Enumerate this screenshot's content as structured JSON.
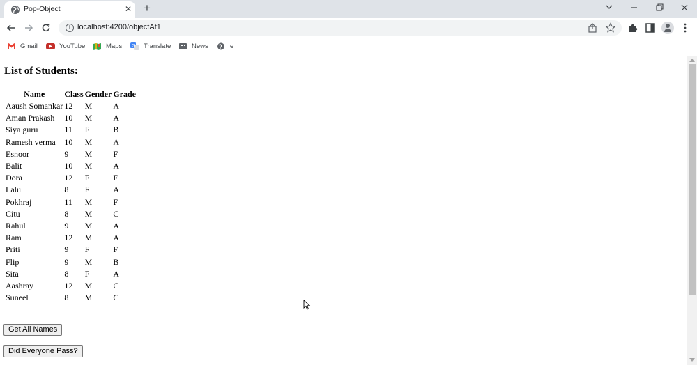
{
  "browser": {
    "tab_title": "Pop-Object",
    "close_glyph": "✕",
    "new_tab_glyph": "+",
    "url": "localhost:4200/objectAt1",
    "bookmarks": [
      {
        "label": "Gmail",
        "icon": "gmail-icon",
        "color": "#ea4335"
      },
      {
        "label": "YouTube",
        "icon": "youtube-icon",
        "color": "#c4302b"
      },
      {
        "label": "Maps",
        "icon": "maps-icon",
        "color": "#34a853"
      },
      {
        "label": "Translate",
        "icon": "translate-icon",
        "color": "#4285f4"
      },
      {
        "label": "News",
        "icon": "news-icon",
        "color": "#5f6368"
      },
      {
        "label": "e",
        "icon": "globe-icon",
        "color": "#5f6368"
      }
    ]
  },
  "page": {
    "title": "List of Students:",
    "columns": [
      "Name",
      "Class",
      "Gender",
      "Grade"
    ],
    "rows": [
      [
        "Aaush Somankar",
        "12",
        "M",
        "A"
      ],
      [
        "Aman Prakash",
        "10",
        "M",
        "A"
      ],
      [
        "Siya guru",
        "11",
        "F",
        "B"
      ],
      [
        "Ramesh verma",
        "10",
        "M",
        "A"
      ],
      [
        "Esnoor",
        "9",
        "M",
        "F"
      ],
      [
        "Balit",
        "10",
        "M",
        "A"
      ],
      [
        "Dora",
        "12",
        "F",
        "F"
      ],
      [
        "Lalu",
        "8",
        "F",
        "A"
      ],
      [
        "Pokhraj",
        "11",
        "M",
        "F"
      ],
      [
        "Citu",
        "8",
        "M",
        "C"
      ],
      [
        "Rahul",
        "9",
        "M",
        "A"
      ],
      [
        "Ram",
        "12",
        "M",
        "A"
      ],
      [
        "Priti",
        "9",
        "F",
        "F"
      ],
      [
        "Flip",
        "9",
        "M",
        "B"
      ],
      [
        "Sita",
        "8",
        "F",
        "A"
      ],
      [
        "Aashray",
        "12",
        "M",
        "C"
      ],
      [
        "Suneel",
        "8",
        "M",
        "C"
      ]
    ],
    "buttons": {
      "get_all_names": "Get All Names",
      "did_everyone_pass": "Did Everyone Pass?"
    }
  }
}
